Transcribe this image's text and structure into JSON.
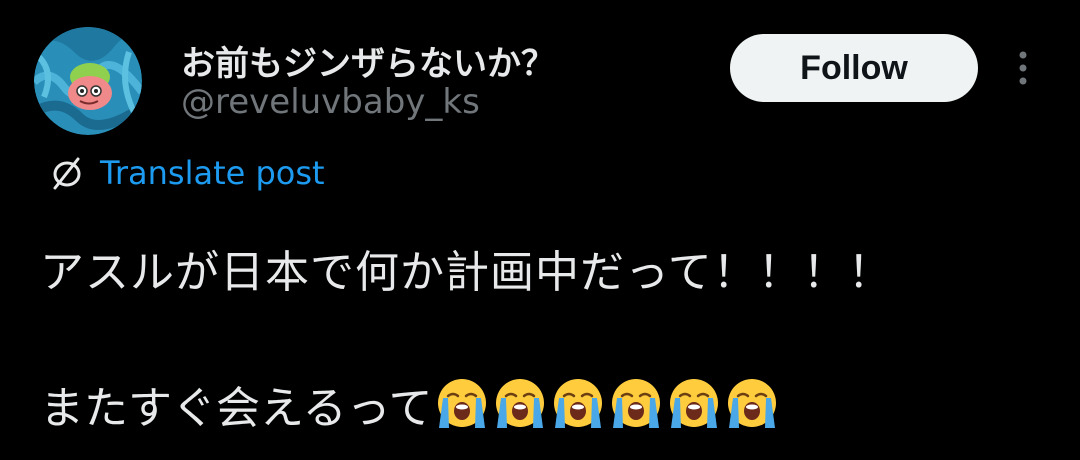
{
  "author": {
    "display_name": "お前もジンザらないか？",
    "handle": "@reveluvbaby_ks",
    "avatar_icon": "avatar-image"
  },
  "actions": {
    "follow_label": "Follow",
    "more_icon": "more-options-icon"
  },
  "translate": {
    "label": "Translate post",
    "icon": "globe-icon"
  },
  "post": {
    "line1": "アスルが日本で何か計画中だって！！！！",
    "line2": "またすぐ会えるって",
    "emoji_name": "loudly-crying-face",
    "emoji_count": 6
  },
  "colors": {
    "background": "#000000",
    "primary_text": "#e7e9ea",
    "secondary_text": "#71767b",
    "link": "#1d9bf0",
    "button_bg": "#eff3f4",
    "button_text": "#0f1419"
  }
}
